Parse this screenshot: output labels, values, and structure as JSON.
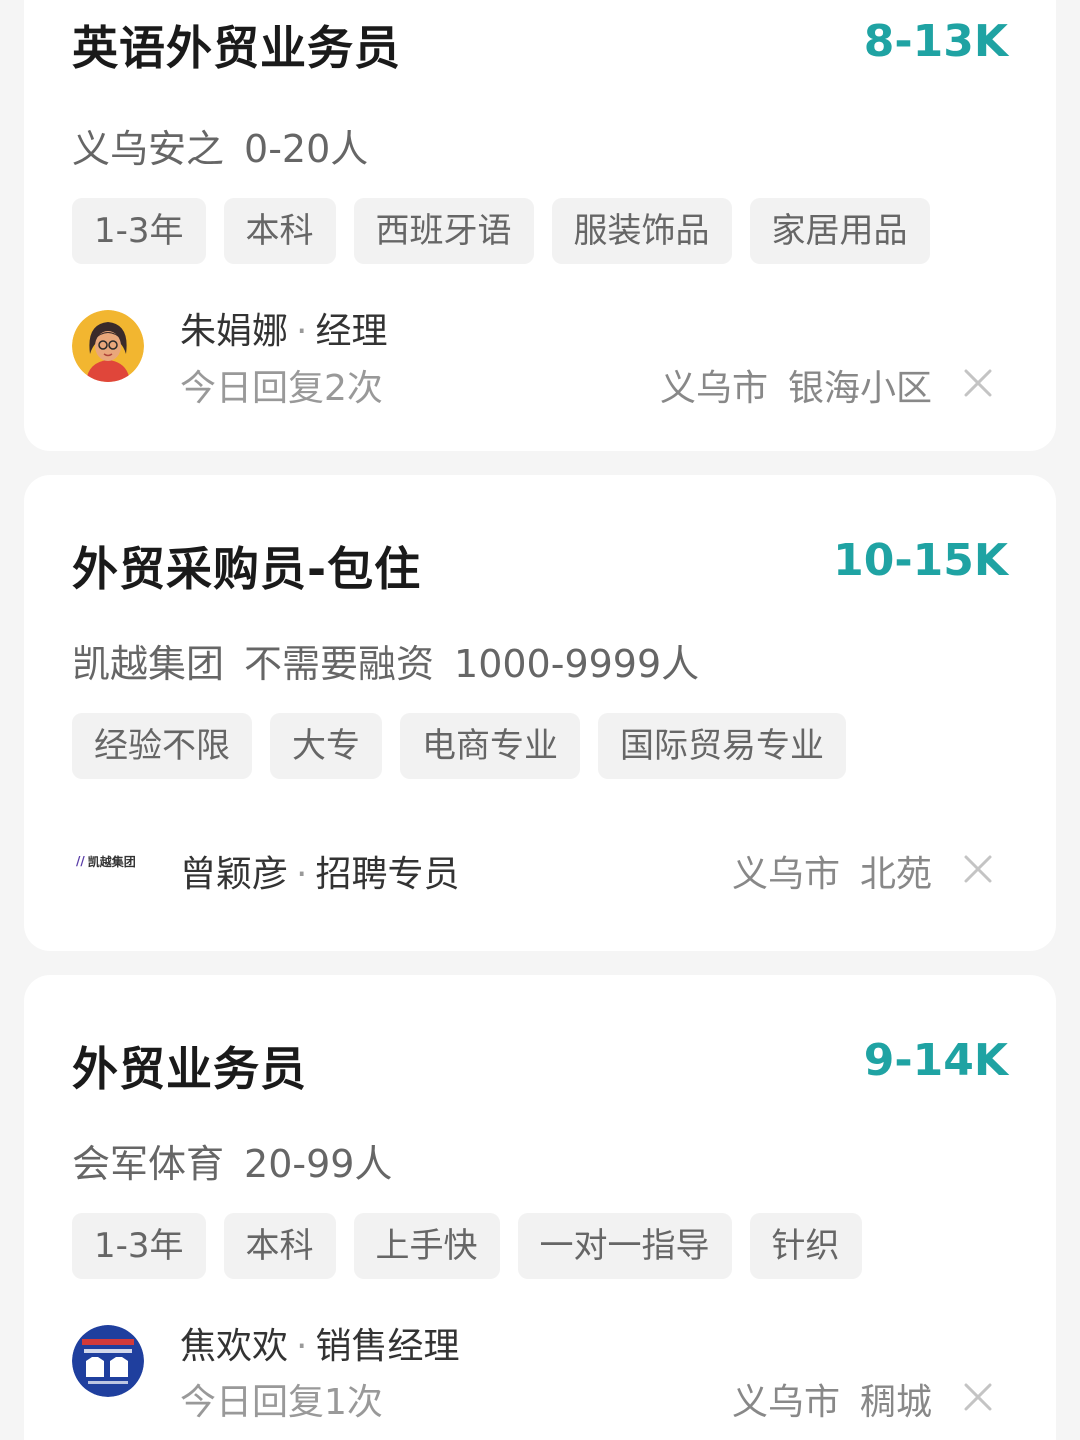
{
  "jobs": [
    {
      "title": "英语外贸业务员",
      "salary": "8-13K",
      "company": "义乌安之",
      "funding": "",
      "size": "0-20人",
      "tags": [
        "1-3年",
        "本科",
        "西班牙语",
        "服装饰品",
        "家居用品"
      ],
      "recruiter_name": "朱娟娜",
      "recruiter_role": "经理",
      "reply_status": "今日回复2次",
      "city": "义乌市",
      "area": "银海小区",
      "avatar_icon": "woman-avatar-icon"
    },
    {
      "title": "外贸采购员-包住",
      "salary": "10-15K",
      "company": "凯越集团",
      "funding": "不需要融资",
      "size": "1000-9999人",
      "tags": [
        "经验不限",
        "大专",
        "电商专业",
        "国际贸易专业"
      ],
      "recruiter_name": "曾颖彦",
      "recruiter_role": "招聘专员",
      "reply_status": "",
      "city": "义乌市",
      "area": "北苑",
      "logo_text": "凯越集团",
      "avatar_icon": "company-logo-icon"
    },
    {
      "title": "外贸业务员",
      "salary": "9-14K",
      "company": "会军体育",
      "funding": "",
      "size": "20-99人",
      "tags": [
        "1-3年",
        "本科",
        "上手快",
        "一对一指导",
        "针织"
      ],
      "recruiter_name": "焦欢欢",
      "recruiter_role": "销售经理",
      "reply_status": "今日回复1次",
      "city": "义乌市",
      "area": "稠城",
      "avatar_icon": "shirt-shop-avatar-icon"
    }
  ],
  "theme": {
    "salary_color": "#1fa3a3",
    "tag_bg": "#f2f2f2",
    "page_bg": "#f5f5f5"
  },
  "icons": {
    "close": "close-icon"
  }
}
